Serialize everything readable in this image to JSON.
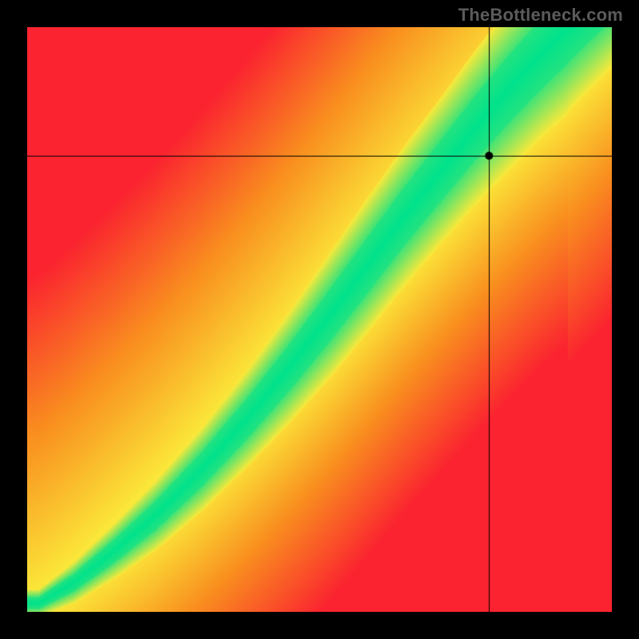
{
  "watermark": "TheBottleneck.com",
  "chart_data": {
    "type": "heatmap",
    "title": "",
    "xlabel": "",
    "ylabel": "",
    "xlim": [
      0,
      1
    ],
    "ylim": [
      0,
      1
    ],
    "crosshair": {
      "x": 0.79,
      "y": 0.78
    },
    "marker": {
      "x": 0.79,
      "y": 0.78,
      "color": "#000000",
      "radius": 5
    },
    "ridge_model": {
      "comment": "Green optimal band runs roughly along y = f(x); width narrows near origin and widens toward top. Values below are (x, y_center, half_width) samples along the ridge, normalized 0..1.",
      "samples": [
        {
          "x": 0.02,
          "y": 0.015,
          "hw": 0.01
        },
        {
          "x": 0.08,
          "y": 0.05,
          "hw": 0.015
        },
        {
          "x": 0.15,
          "y": 0.105,
          "hw": 0.02
        },
        {
          "x": 0.22,
          "y": 0.165,
          "hw": 0.025
        },
        {
          "x": 0.3,
          "y": 0.245,
          "hw": 0.03
        },
        {
          "x": 0.38,
          "y": 0.335,
          "hw": 0.035
        },
        {
          "x": 0.45,
          "y": 0.42,
          "hw": 0.04
        },
        {
          "x": 0.52,
          "y": 0.51,
          "hw": 0.045
        },
        {
          "x": 0.58,
          "y": 0.59,
          "hw": 0.048
        },
        {
          "x": 0.64,
          "y": 0.67,
          "hw": 0.05
        },
        {
          "x": 0.7,
          "y": 0.745,
          "hw": 0.052
        },
        {
          "x": 0.76,
          "y": 0.82,
          "hw": 0.055
        },
        {
          "x": 0.82,
          "y": 0.89,
          "hw": 0.058
        },
        {
          "x": 0.88,
          "y": 0.955,
          "hw": 0.06
        },
        {
          "x": 0.92,
          "y": 0.995,
          "hw": 0.062
        }
      ]
    },
    "gradient_side": {
      "comment": "Far from ridge, field grades from red (distance large on the low side / bottom-right) through orange to yellow near ridge shoulders; upper-right corner tends yellow.",
      "colors": {
        "green": "#00E28C",
        "yellow": "#FCE93A",
        "orange": "#F98F1F",
        "red": "#FB2330"
      }
    }
  }
}
